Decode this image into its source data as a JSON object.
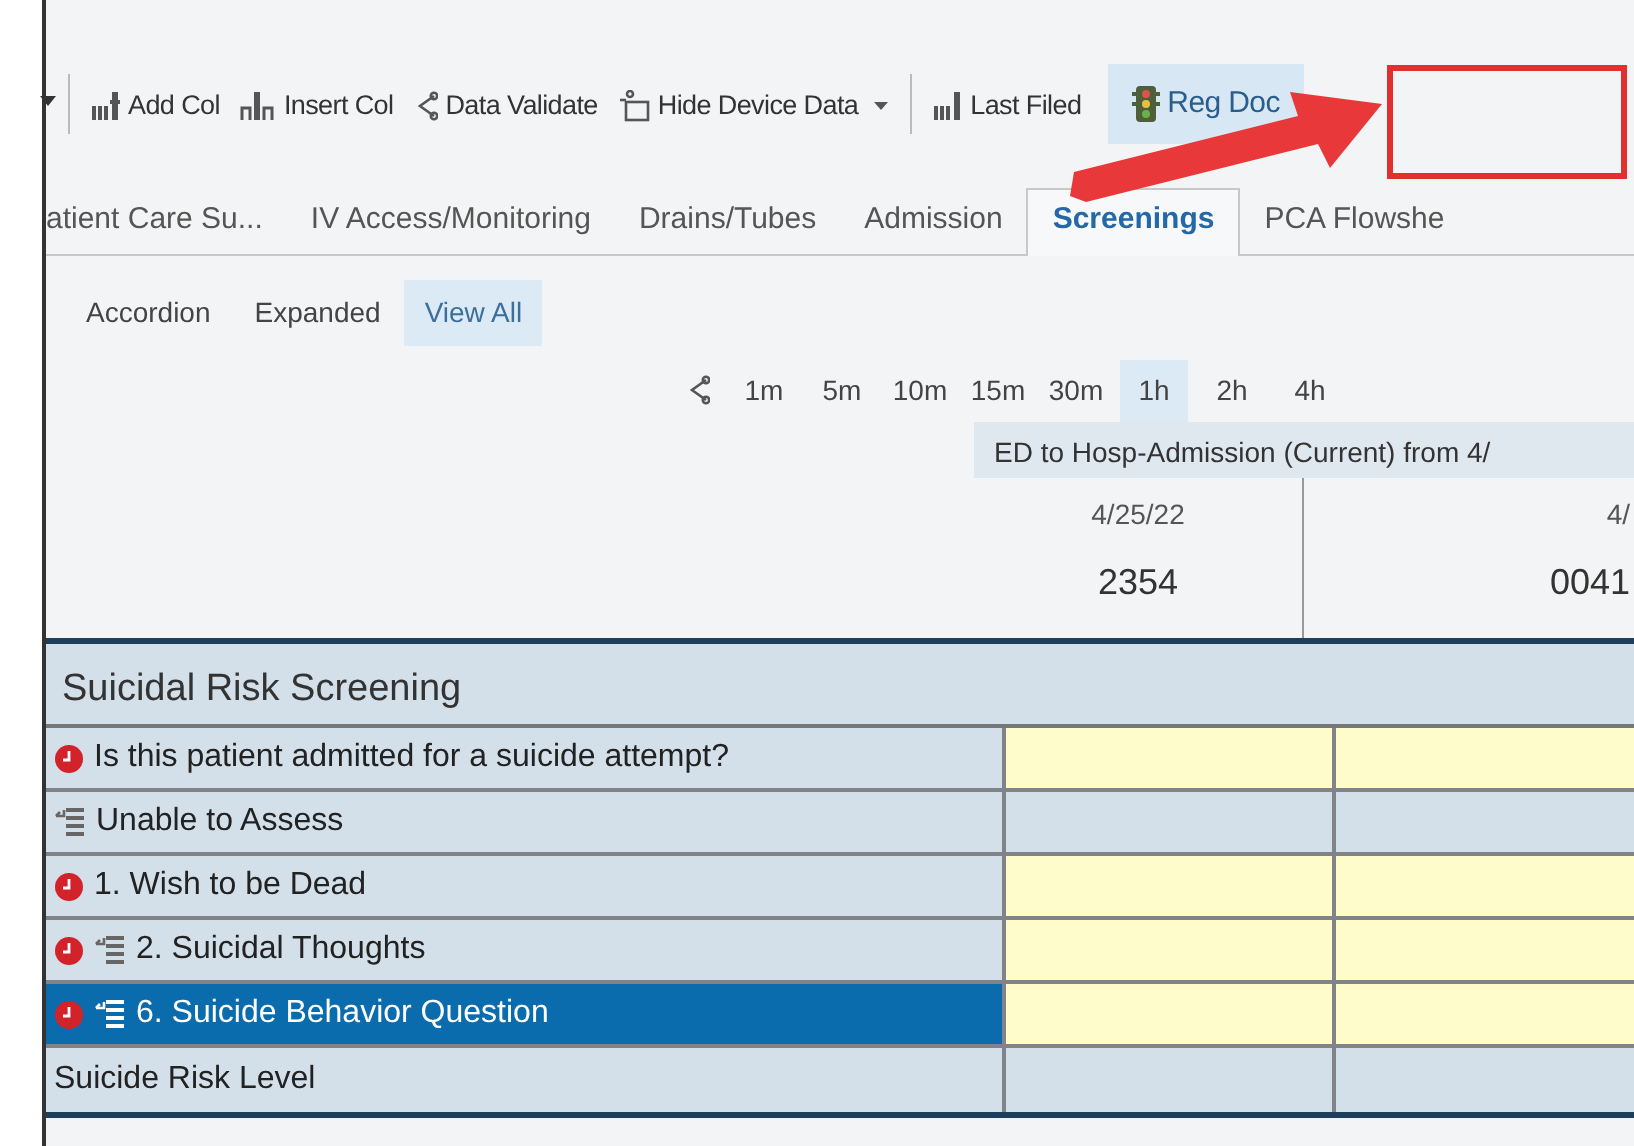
{
  "toolbar": {
    "items": [
      {
        "kind": "addcol",
        "label": "Add Col",
        "dropdown": false,
        "highlighted": false
      },
      {
        "kind": "insertcol",
        "label": "Insert Col",
        "dropdown": false,
        "highlighted": false
      },
      {
        "kind": "validate",
        "label": "Data Validate",
        "dropdown": false,
        "highlighted": false
      },
      {
        "kind": "hide",
        "label": "Hide Device Data",
        "dropdown": true,
        "highlighted": false
      },
      {
        "kind": "filed",
        "label": "Last Filed",
        "dropdown": false,
        "highlighted": false
      },
      {
        "kind": "regdoc",
        "label": "Reg Doc",
        "dropdown": false,
        "highlighted": true
      }
    ]
  },
  "tabs": [
    {
      "label": "atient Care Su...",
      "selected": false
    },
    {
      "label": "IV Access/Monitoring",
      "selected": false
    },
    {
      "label": "Drains/Tubes",
      "selected": false
    },
    {
      "label": "Admission",
      "selected": false
    },
    {
      "label": "Screenings",
      "selected": true
    },
    {
      "label": "PCA Flowshe",
      "selected": false
    }
  ],
  "views": [
    {
      "label": "Accordion",
      "selected": false
    },
    {
      "label": "Expanded",
      "selected": false
    },
    {
      "label": "View All",
      "selected": true
    }
  ],
  "intervals": [
    {
      "label": "1m",
      "selected": false
    },
    {
      "label": "5m",
      "selected": false
    },
    {
      "label": "10m",
      "selected": false
    },
    {
      "label": "15m",
      "selected": false
    },
    {
      "label": "30m",
      "selected": false
    },
    {
      "label": "1h",
      "selected": true
    },
    {
      "label": "2h",
      "selected": false
    },
    {
      "label": "4h",
      "selected": false
    }
  ],
  "encounter": "ED to Hosp-Admission (Current) from 4/",
  "columns": [
    {
      "date": "4/25/22",
      "time": "2354"
    },
    {
      "date": "4/",
      "time": "0041"
    }
  ],
  "section": "Suicidal Risk Screening",
  "rows": [
    {
      "label": "Is this patient admitted for a suicide attempt?",
      "required": true,
      "linked": false,
      "selected": false
    },
    {
      "label": "Unable to Assess",
      "required": false,
      "linked": true,
      "selected": false
    },
    {
      "label": "1. Wish to be Dead",
      "required": true,
      "linked": false,
      "selected": false
    },
    {
      "label": "2. Suicidal Thoughts",
      "required": true,
      "linked": true,
      "selected": false
    },
    {
      "label": "6. Suicide Behavior Question",
      "required": true,
      "linked": true,
      "selected": true
    },
    {
      "label": "Suicide Risk Level",
      "required": false,
      "linked": false,
      "selected": false
    }
  ]
}
